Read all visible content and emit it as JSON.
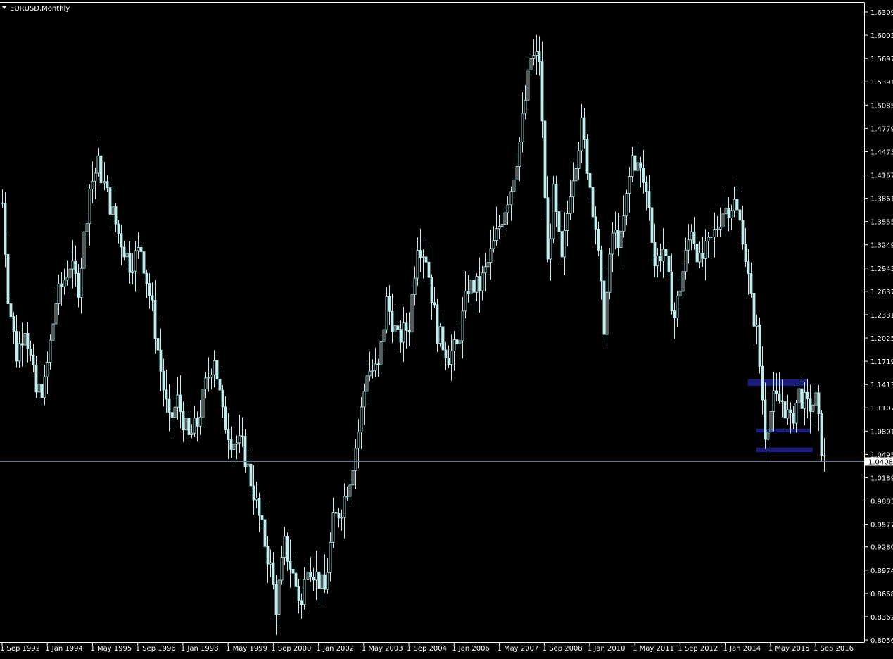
{
  "window": {
    "title": "EURUSD,Monthly",
    "background_color": "#000000",
    "foreground_color": "#ffffff",
    "icon": "triangle-down-icon"
  },
  "chart_data": {
    "type": "candlestick",
    "symbol": "EURUSD",
    "timeframe": "Monthly",
    "candle_color": "#bfeef0",
    "grid": false,
    "ylim": [
      0.8056,
      1.6339
    ],
    "xlim": [
      "1992-09",
      "2016-12"
    ],
    "y_ticks": [
      "1.63090",
      "1.60030",
      "1.56970",
      "1.53910",
      "1.50850",
      "1.47790",
      "1.44730",
      "1.41670",
      "1.38610",
      "1.35550",
      "1.32490",
      "1.29430",
      "1.26370",
      "1.23310",
      "1.20250",
      "1.17190",
      "1.14130",
      "1.11070",
      "1.08010",
      "1.04950",
      "1.01890",
      "0.98830",
      "0.95770",
      "0.92800",
      "0.89740",
      "0.86680",
      "0.83620",
      "0.80560"
    ],
    "x_ticks": [
      {
        "label": "1 Sep 1992",
        "date": "1992-09"
      },
      {
        "label": "1 Jan 1994",
        "date": "1994-01"
      },
      {
        "label": "1 May 1995",
        "date": "1995-05"
      },
      {
        "label": "1 Sep 1996",
        "date": "1996-09"
      },
      {
        "label": "1 Jan 1998",
        "date": "1998-01"
      },
      {
        "label": "1 May 1999",
        "date": "1999-05"
      },
      {
        "label": "1 Sep 2000",
        "date": "2000-09"
      },
      {
        "label": "1 Jan 2002",
        "date": "2002-01"
      },
      {
        "label": "1 May 2003",
        "date": "2003-05"
      },
      {
        "label": "1 Sep 2004",
        "date": "2004-09"
      },
      {
        "label": "1 Jan 2006",
        "date": "2006-01"
      },
      {
        "label": "1 May 2007",
        "date": "2007-05"
      },
      {
        "label": "1 Sep 2008",
        "date": "2008-09"
      },
      {
        "label": "1 Jan 2010",
        "date": "2010-01"
      },
      {
        "label": "1 May 2011",
        "date": "2011-05"
      },
      {
        "label": "1 Sep 2012",
        "date": "2012-09"
      },
      {
        "label": "1 Jan 2014",
        "date": "2014-01"
      },
      {
        "label": "1 May 2015",
        "date": "2015-05"
      },
      {
        "label": "1 Sep 2016",
        "date": "2016-09"
      }
    ],
    "current_price": {
      "value": 1.04083,
      "label": "1.04083",
      "line_color": "#4a7fa8"
    },
    "price_path": [
      [
        "1992-09",
        1.38
      ],
      [
        "1992-11",
        1.26
      ],
      [
        "1993-02",
        1.18
      ],
      [
        "1993-05",
        1.22
      ],
      [
        "1993-09",
        1.13
      ],
      [
        "1993-12",
        1.14
      ],
      [
        "1994-04",
        1.25
      ],
      [
        "1994-09",
        1.3
      ],
      [
        "1994-12",
        1.27
      ],
      [
        "1995-04",
        1.4
      ],
      [
        "1995-07",
        1.43
      ],
      [
        "1995-10",
        1.39
      ],
      [
        "1996-02",
        1.34
      ],
      [
        "1996-06",
        1.3
      ],
      [
        "1996-10",
        1.32
      ],
      [
        "1997-02",
        1.24
      ],
      [
        "1997-05",
        1.16
      ],
      [
        "1997-08",
        1.09
      ],
      [
        "1997-11",
        1.12
      ],
      [
        "1998-03",
        1.07
      ],
      [
        "1998-06",
        1.09
      ],
      [
        "1998-09",
        1.14
      ],
      [
        "1998-12",
        1.18
      ],
      [
        "1999-03",
        1.1
      ],
      [
        "1999-06",
        1.07
      ],
      [
        "1999-10",
        1.06
      ],
      [
        "2000-02",
        1.0
      ],
      [
        "2000-05",
        0.95
      ],
      [
        "2000-08",
        0.9
      ],
      [
        "2000-10",
        0.85
      ],
      [
        "2001-01",
        0.93
      ],
      [
        "2001-04",
        0.89
      ],
      [
        "2001-07",
        0.85
      ],
      [
        "2001-09",
        0.91
      ],
      [
        "2001-12",
        0.89
      ],
      [
        "2002-03",
        0.87
      ],
      [
        "2002-06",
        0.96
      ],
      [
        "2002-09",
        0.98
      ],
      [
        "2002-12",
        1.02
      ],
      [
        "2003-03",
        1.08
      ],
      [
        "2003-06",
        1.16
      ],
      [
        "2003-10",
        1.16
      ],
      [
        "2004-01",
        1.25
      ],
      [
        "2004-05",
        1.2
      ],
      [
        "2004-09",
        1.22
      ],
      [
        "2004-12",
        1.33
      ],
      [
        "2005-03",
        1.31
      ],
      [
        "2005-07",
        1.21
      ],
      [
        "2005-11",
        1.18
      ],
      [
        "2006-02",
        1.19
      ],
      [
        "2006-06",
        1.27
      ],
      [
        "2006-10",
        1.27
      ],
      [
        "2007-01",
        1.3
      ],
      [
        "2007-05",
        1.35
      ],
      [
        "2007-09",
        1.4
      ],
      [
        "2007-12",
        1.46
      ],
      [
        "2008-04",
        1.57
      ],
      [
        "2008-07",
        1.57
      ],
      [
        "2008-10",
        1.3
      ],
      [
        "2008-12",
        1.39
      ],
      [
        "2009-03",
        1.3
      ],
      [
        "2009-06",
        1.4
      ],
      [
        "2009-10",
        1.48
      ],
      [
        "2009-12",
        1.43
      ],
      [
        "2010-03",
        1.35
      ],
      [
        "2010-06",
        1.22
      ],
      [
        "2010-09",
        1.34
      ],
      [
        "2010-12",
        1.33
      ],
      [
        "2011-04",
        1.44
      ],
      [
        "2011-07",
        1.42
      ],
      [
        "2011-10",
        1.38
      ],
      [
        "2011-12",
        1.3
      ],
      [
        "2012-03",
        1.32
      ],
      [
        "2012-07",
        1.23
      ],
      [
        "2012-10",
        1.29
      ],
      [
        "2013-01",
        1.35
      ],
      [
        "2013-04",
        1.3
      ],
      [
        "2013-08",
        1.33
      ],
      [
        "2013-12",
        1.37
      ],
      [
        "2014-04",
        1.38
      ],
      [
        "2014-07",
        1.34
      ],
      [
        "2014-10",
        1.25
      ],
      [
        "2014-12",
        1.21
      ],
      [
        "2015-03",
        1.08
      ],
      [
        "2015-06",
        1.12
      ],
      [
        "2015-09",
        1.12
      ],
      [
        "2015-12",
        1.09
      ],
      [
        "2016-03",
        1.13
      ],
      [
        "2016-06",
        1.11
      ],
      [
        "2016-09",
        1.12
      ],
      [
        "2016-11",
        1.06
      ],
      [
        "2016-12",
        1.04
      ]
    ],
    "annotations": [
      {
        "type": "rectangle",
        "from": "2014-09",
        "to": "2016-06",
        "y_low": 1.1395,
        "y_high": 1.1485,
        "color": "#1c1c7a"
      },
      {
        "type": "rectangle",
        "from": "2014-12",
        "to": "2016-07",
        "y_low": 1.0785,
        "y_high": 1.0835,
        "color": "#1c1c7a"
      },
      {
        "type": "rectangle",
        "from": "2014-12",
        "to": "2016-08",
        "y_low": 1.0525,
        "y_high": 1.0585,
        "color": "#1c1c7a"
      }
    ]
  }
}
